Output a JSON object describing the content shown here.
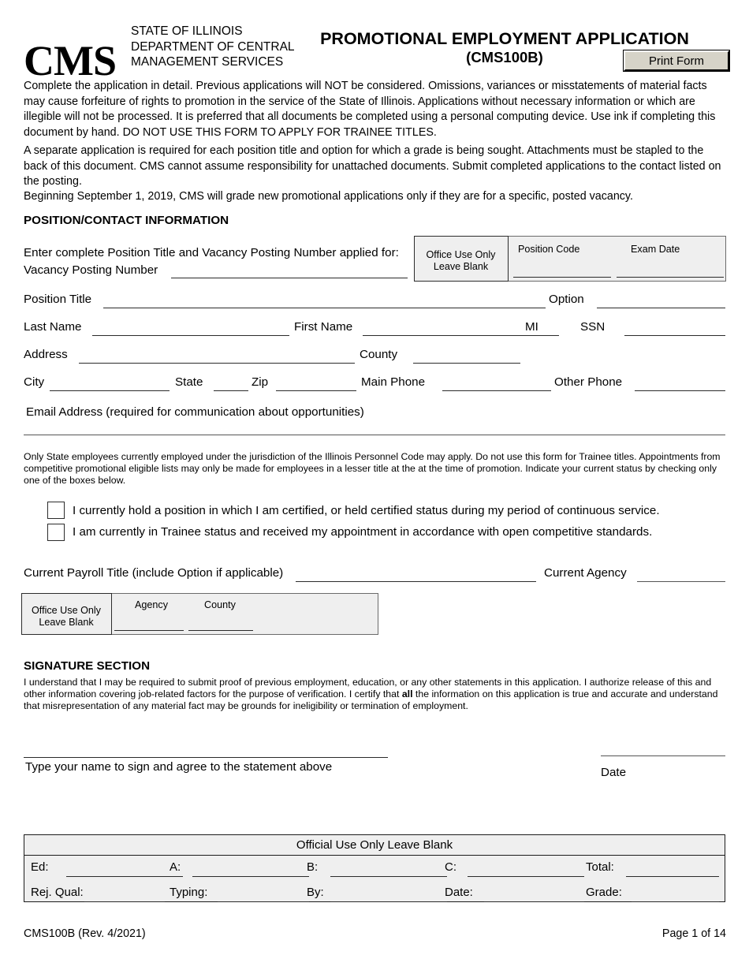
{
  "header": {
    "logo_text": "CMS",
    "agency_line1": "STATE OF ILLINOIS",
    "agency_line2": "DEPARTMENT OF CENTRAL",
    "agency_line3": "MANAGEMENT SERVICES",
    "doc_title": "PROMOTIONAL EMPLOYMENT APPLICATION",
    "doc_subtitle": "(CMS100B)",
    "print_button": "Print Form"
  },
  "intro": {
    "paragraph1": "Complete the application in detail.  Previous applications will NOT be considered. Omissions, variances or misstatements of material facts may cause forfeiture of rights to promotion in the service of the State of Illinois. Applications without necessary information or which are illegible will not be processed. It is preferred that all documents be completed using a personal computing device. Use ink if completing this document by hand. DO NOT USE THIS FORM TO APPLY FOR TRAINEE TITLES.",
    "paragraph2": "A separate application is required for each position title and option for which a grade is being sought. Attachments must be stapled to the back of this document. CMS cannot assume responsibility for unattached documents. Submit completed applications to the contact listed on the posting.",
    "paragraph3": "Beginning September 1, 2019, CMS will grade new promotional applications only if they are for a specific, posted vacancy."
  },
  "position_section": {
    "heading": "POSITION/CONTACT INFORMATION",
    "instruction": "Enter complete Position Title and Vacancy Posting Number applied for:",
    "vacancy_posting_number_label": "Vacancy Posting Number",
    "vacancy_posting_number_value": "",
    "office_use_box": {
      "line1": "Office Use Only",
      "line2": "Leave Blank",
      "position_code_label": "Position Code",
      "position_code_value": "",
      "exam_date_label": "Exam Date",
      "exam_date_value": ""
    },
    "fields": {
      "position_title_label": "Position Title",
      "position_title_value": "",
      "option_label": "Option",
      "option_value": "",
      "last_name_label": "Last Name",
      "last_name_value": "",
      "first_name_label": "First Name",
      "first_name_value": "",
      "mi_label": "MI",
      "mi_value": "",
      "ssn_label": "SSN",
      "ssn_value": "",
      "address_label": "Address",
      "address_value": "",
      "county_label": "County",
      "county_value": "",
      "city_label": "City",
      "city_value": "",
      "state_label": "State",
      "state_value": "",
      "zip_label": "Zip",
      "zip_value": "",
      "main_phone_label": "Main Phone",
      "main_phone_value": "",
      "other_phone_label": "Other Phone",
      "other_phone_value": "",
      "email_label": "Email Address (required for communication about opportunities)",
      "email_value": ""
    }
  },
  "eligibility": {
    "note": "Only State employees currently employed under the jurisdiction of the Illinois Personnel Code may apply.  Do not use this form for Trainee titles.  Appointments from competitive promotional eligible lists may only be made for employees in a lesser title at the at the time of promotion.  Indicate your current status by checking only one of the boxes below.",
    "checkbox1_label": "I currently hold a position in which I am certified, or held certified status during my period of continuous service.",
    "checkbox2_label": "I am currently in Trainee status and received my appointment in accordance with open competitive standards.",
    "checkbox1_checked": false,
    "checkbox2_checked": false
  },
  "current_employment": {
    "payroll_title_label": "Current Payroll Title (include Option if applicable)",
    "payroll_title_value": "",
    "current_agency_label": "Current Agency",
    "current_agency_value": "",
    "office_use_box": {
      "line1": "Office Use Only",
      "line2": "Leave Blank",
      "agency_label": "Agency",
      "agency_value": "",
      "county_label": "County",
      "county_value": ""
    }
  },
  "signature_section": {
    "heading": "SIGNATURE SECTION",
    "statement_part1": "I understand that I may be required to submit proof of previous employment, education, or any other statements in this application.  I authorize release of this and other information covering job-related factors for the purpose of verification.  I certify that ",
    "statement_bold": "all",
    "statement_part2": " the information on this application is true and accurate and understand that misrepresentation of any material fact may be grounds for ineligibility or termination of employment.",
    "signature_caption": "Type your name to sign and agree to the statement above",
    "signature_value": "",
    "date_label": "Date",
    "date_value": ""
  },
  "official_use_table": {
    "title": "Official Use Only Leave Blank",
    "row1": [
      {
        "label": "Ed:",
        "value": ""
      },
      {
        "label": "A:",
        "value": ""
      },
      {
        "label": "B:",
        "value": ""
      },
      {
        "label": "C:",
        "value": ""
      },
      {
        "label": "Total:",
        "value": ""
      }
    ],
    "row2": [
      {
        "label": "Rej. Qual:",
        "value": ""
      },
      {
        "label": "Typing:",
        "value": ""
      },
      {
        "label": "By:",
        "value": ""
      },
      {
        "label": "Date:",
        "value": ""
      },
      {
        "label": "Grade:",
        "value": ""
      }
    ]
  },
  "footer": {
    "form_id": "CMS100B (Rev. 4/2021)",
    "page_number": "Page 1 of 14"
  },
  "colors": {
    "office_box_fill": "#efefef",
    "button_face": "#d6d3c8",
    "rule": "#2b2b2b"
  }
}
